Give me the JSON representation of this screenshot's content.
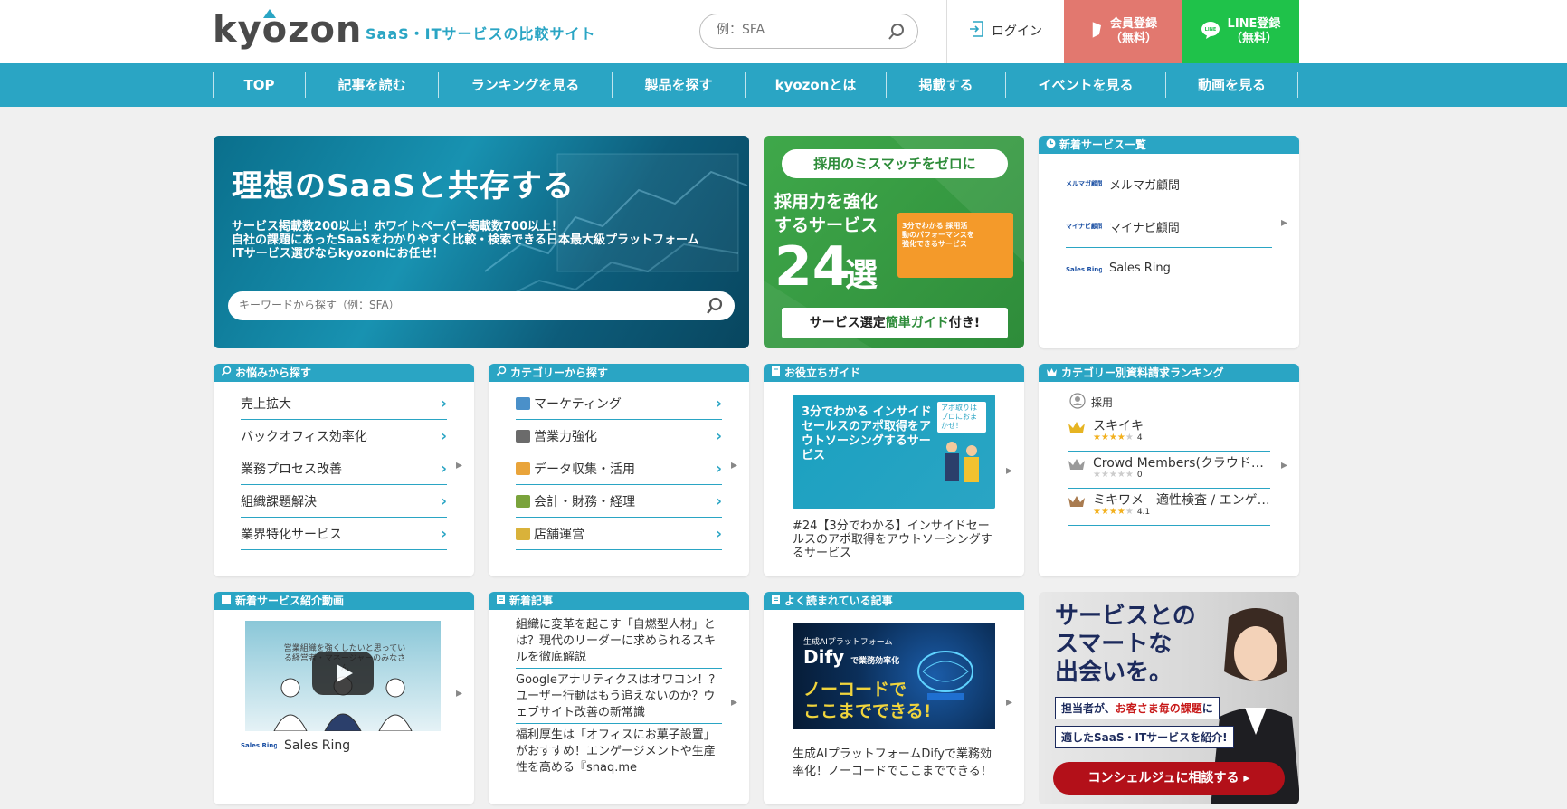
{
  "header": {
    "logo": "kyozon",
    "tagline": "SaaS・ITサービスの比較サイト",
    "search_placeholder": "例：SFA",
    "login": "ログイン",
    "member_btn": "会員登録\n（無料）",
    "member_l1": "会員登録",
    "member_l2": "（無料）",
    "line_l1": "LINE登録",
    "line_l2": "（無料）"
  },
  "nav": [
    "TOP",
    "記事を読む",
    "ランキングを見る",
    "製品を探す",
    "kyozonとは",
    "掲載する",
    "イベントを見る",
    "動画を見る"
  ],
  "hero": {
    "title": "理想のSaaSと共存する",
    "sub1": "サービス掲載数200以上！ホワイトペーパー掲載数700以上！",
    "sub2": "自社の課題にあったSaaSをわかりやすく比較・検索できる日本最大級プラットフォーム",
    "sub3": "ITサービス選びならkyozonにお任せ！",
    "search_placeholder": "キーワードから探す（例：SFA）"
  },
  "promo": {
    "top": "採用のミスマッチをゼロに",
    "t1": "採用力を強化",
    "t2": "するサービス",
    "num": "24",
    "sen": "選",
    "img_text": "3分でわかる 採用活動のパフォーマンスを強化できるサービス",
    "bottom_a": "サービス選定",
    "bottom_b": "簡単ガイド",
    "bottom_c": "付き!"
  },
  "new_services": {
    "title": "新着サービス一覧",
    "items": [
      {
        "logo": "メルマガ顧問",
        "name": "メルマガ顧問"
      },
      {
        "logo": "マイナビ顧問",
        "name": "マイナビ顧問"
      },
      {
        "logo": "Sales Ring",
        "name": "Sales Ring"
      }
    ]
  },
  "worries": {
    "title": "お悩みから探す",
    "items": [
      "売上拡大",
      "バックオフィス効率化",
      "業務プロセス改善",
      "組織課題解決",
      "業界特化サービス"
    ]
  },
  "categories": {
    "title": "カテゴリーから探す",
    "items": [
      "マーケティング",
      "営業力強化",
      "データ収集・活用",
      "会計・財務・経理",
      "店舗運営"
    ]
  },
  "guide": {
    "title": "お役立ちガイド",
    "img_text": "3分でわかる インサイドセールスのアポ取得をアウトソーシングするサービス",
    "img_badge": "アポ取りはプロにおまかせ！",
    "caption": "#24【3分でわかる】インサイドセールスのアポ取得をアウトソーシングするサービス"
  },
  "ranking": {
    "title": "カテゴリー別資料請求ランキング",
    "category": "採用",
    "items": [
      {
        "name": "スキイキ",
        "rating": "4",
        "stars": 4
      },
      {
        "name": "Crowd Members(クラウド…",
        "rating": "0",
        "stars": 0
      },
      {
        "name": "ミキワメ　適性検査 / エンゲ…",
        "rating": "4.1",
        "stars": 4
      }
    ]
  },
  "video": {
    "title": "新着サービス紹介動画",
    "thumb_text": "営業組織を強くしたいと思っている経営者・マネージャーのみなさん",
    "caption": "Sales Ring",
    "logo": "Sales Ring"
  },
  "news": {
    "title": "新着記事",
    "items": [
      "組織に変革を起こす「自燃型人材」とは？現代のリーダーに求められるスキルを徹底解説",
      "Googleアナリティクスはオワコン！？ユーザー行動はもう追えないのか？ウェブサイト改善の新常識",
      "福利厚生は「オフィスにお菓子設置」がおすすめ！エンゲージメントや生産性を高める『snaq.me"
    ]
  },
  "popular": {
    "title": "よく読まれている記事",
    "img_t": "生成AIプラットフォーム",
    "img_d": "Dify",
    "img_d2": "で業務効率化",
    "img_n1": "ノーコードで",
    "img_n2": "ここまでできる!",
    "caption": "生成AIプラットフォームDifyで業務効率化！ノーコードでここまでできる！"
  },
  "concierge": {
    "l1": "サービスとの",
    "l2": "スマートな",
    "l3": "出会いを。",
    "line1a": "担当者が、",
    "line1b": "お客さま毎の課題",
    "line1c": "に",
    "line2": "適したSaaS・ITサービスを紹介!",
    "btn": "コンシェルジュに相談する ▸"
  },
  "colors": {
    "brand": "#2aa5c4",
    "member": "#e2786f",
    "line": "#1fc24a",
    "cta": "#b31019"
  }
}
